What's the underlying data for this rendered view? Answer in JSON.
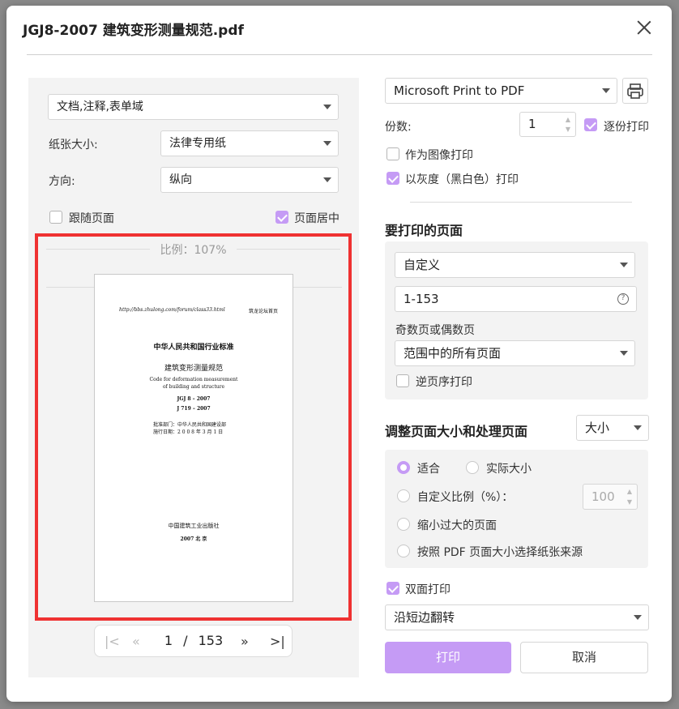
{
  "dialog": {
    "title": "JGJ8-2007 建筑变形测量规范.pdf"
  },
  "left_panel": {
    "content_select": "文档,注释,表单域",
    "paper_size_label": "纸张大小:",
    "paper_size_value": "法律专用纸",
    "orientation_label": "方向:",
    "orientation_value": "纵向",
    "follow_page_label": "跟随页面",
    "follow_page_checked": false,
    "center_page_label": "页面居中",
    "center_page_checked": true,
    "scale_text": "比例：107%"
  },
  "page_preview": {
    "url": "http://bbs.zhulong.com/forum/class33.html",
    "header_right": "筑龙论坛首页",
    "standard_title": "中华人民共和国行业标准",
    "doc_title_cn": "建筑变形测量规范",
    "doc_title_en_1": "Code for deformation measurement",
    "doc_title_en_2": "of building and structure",
    "code_1": "JGJ 8 – 2007",
    "code_2": "J 719 – 2007",
    "approved_by": "批准部门：中华人民共和国建设部",
    "effective_date": "施行日期：2 0 0 8 年  3  月  1  日",
    "publisher": "中国建筑工业出版社",
    "publish_place": "2007    北    京"
  },
  "pager": {
    "first": "|<",
    "prev": "«",
    "current_page": "1",
    "separator": "/",
    "total_pages": "153",
    "next": "»",
    "last": ">|"
  },
  "right_panel": {
    "printer": "Microsoft Print to PDF",
    "copies_label": "份数:",
    "copies_value": "1",
    "collate_label": "逐份打印",
    "collate_checked": true,
    "print_as_image_label": "作为图像打印",
    "print_as_image_checked": false,
    "grayscale_label": "以灰度（黑白色）打印",
    "grayscale_checked": true,
    "pages_section_title": "要打印的页面",
    "pages_mode": "自定义",
    "page_range": "1-153",
    "odd_even_label": "奇数页或偶数页",
    "odd_even_value": "范围中的所有页面",
    "reverse_label": "逆页序打印",
    "reverse_checked": false,
    "resize_section_title": "调整页面大小和处理页面",
    "resize_mode": "大小",
    "fit_label": "适合",
    "actual_size_label": "实际大小",
    "custom_scale_label": "自定义比例（%）：",
    "custom_scale_value": "100",
    "shrink_label": "缩小过大的页面",
    "paper_source_label": "按照 PDF 页面大小选择纸张来源",
    "duplex_label": "双面打印",
    "duplex_checked": true,
    "flip_value": "沿短边翻转",
    "print_button": "打印",
    "cancel_button": "取消"
  }
}
